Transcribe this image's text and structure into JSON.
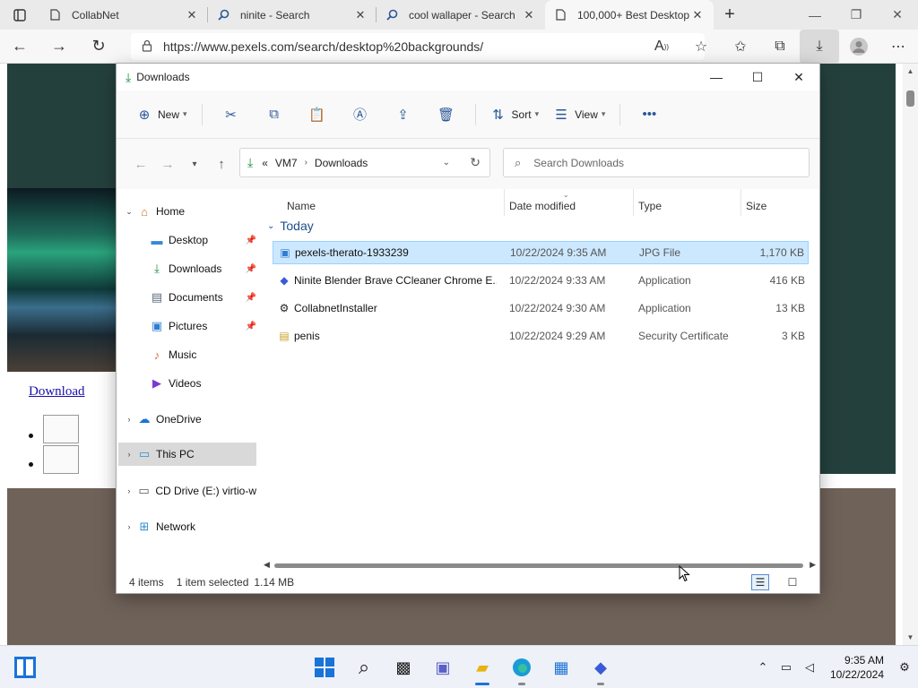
{
  "browser": {
    "tabs": [
      {
        "label": "CollabNet",
        "icon": "page-icon"
      },
      {
        "label": "ninite - Search",
        "icon": "search-icon"
      },
      {
        "label": "cool wallaper - Search",
        "icon": "search-icon"
      },
      {
        "label": "100,000+ Best Desktop",
        "icon": "page-icon",
        "active": true
      }
    ],
    "url": "https://www.pexels.com/search/desktop%20backgrounds/"
  },
  "webpage": {
    "download_link": "Download"
  },
  "explorer": {
    "title": "Downloads",
    "toolbar": {
      "new_label": "New",
      "sort_label": "Sort",
      "view_label": "View"
    },
    "breadcrumb": {
      "prefix": "«",
      "parts": [
        "VM7",
        "Downloads"
      ]
    },
    "search_placeholder": "Search Downloads",
    "sidebar": [
      {
        "label": "Home",
        "icon": "home-icon",
        "expander": "down"
      },
      {
        "label": "Desktop",
        "icon": "desktop-icon",
        "pinned": true
      },
      {
        "label": "Downloads",
        "icon": "download-icon",
        "pinned": true
      },
      {
        "label": "Documents",
        "icon": "documents-icon",
        "pinned": true
      },
      {
        "label": "Pictures",
        "icon": "pictures-icon",
        "pinned": true
      },
      {
        "label": "Music",
        "icon": "music-icon",
        "pinned": true
      },
      {
        "label": "Videos",
        "icon": "videos-icon",
        "pinned": true
      },
      {
        "label": "OneDrive",
        "icon": "cloud-icon",
        "expander": "right"
      },
      {
        "label": "This PC",
        "icon": "pc-icon",
        "expander": "right",
        "selected": true
      },
      {
        "label": "CD Drive (E:) virtio-w",
        "icon": "cd-drive-icon",
        "expander": "right"
      },
      {
        "label": "Network",
        "icon": "network-icon",
        "expander": "right"
      }
    ],
    "columns": [
      "Name",
      "Date modified",
      "Type",
      "Size"
    ],
    "group_label": "Today",
    "files": [
      {
        "name": "pexels-therato-1933239",
        "date": "10/22/2024 9:35 AM",
        "type": "JPG File",
        "size": "1,170 KB",
        "icon": "image-file-icon",
        "selected": true
      },
      {
        "name": "Ninite Blender Brave CCleaner Chrome E...",
        "date": "10/22/2024 9:33 AM",
        "type": "Application",
        "size": "416 KB",
        "icon": "ninite-app-icon"
      },
      {
        "name": "CollabnetInstaller",
        "date": "10/22/2024 9:30 AM",
        "type": "Application",
        "size": "13 KB",
        "icon": "installer-app-icon"
      },
      {
        "name": "penis",
        "date": "10/22/2024 9:29 AM",
        "type": "Security Certificate",
        "size": "3 KB",
        "icon": "certificate-icon"
      }
    ],
    "status": {
      "items": "4 items",
      "selected": "1 item selected",
      "size": "1.14 MB"
    }
  },
  "taskbar": {
    "time": "9:35 AM",
    "date": "10/22/2024"
  },
  "colors": {
    "accent": "#1a73d9",
    "selection": "#cce8ff",
    "page_bg": "#24403d"
  }
}
